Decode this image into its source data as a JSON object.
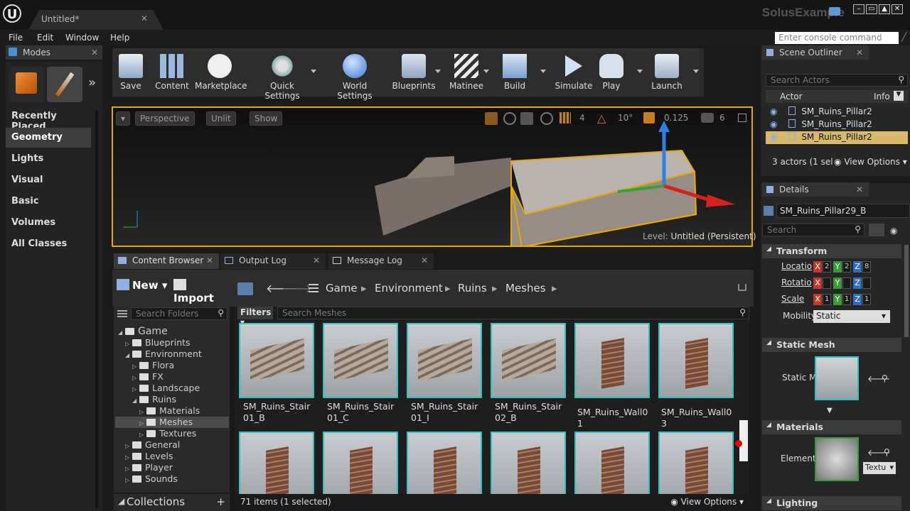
{
  "app": {
    "logo": "U",
    "project": "SolusExample",
    "doc_tab": "Untitled*"
  },
  "menu": [
    "File",
    "Edit",
    "Window",
    "Help"
  ],
  "console_placeholder": "Enter console command",
  "modes": {
    "tab": "Modes",
    "categories": [
      "Recently Placed",
      "Geometry",
      "Lights",
      "Visual",
      "Basic",
      "Volumes",
      "All Classes"
    ],
    "selected": "Geometry"
  },
  "toolbar": [
    "Save",
    "Content",
    "Marketplace",
    "Quick Settings",
    "World Settings",
    "Blueprints",
    "Matinee",
    "Build",
    "Simulate",
    "Play",
    "Launch"
  ],
  "viewport": {
    "perspective": "Perspective",
    "unlit": "Unlit",
    "show": "Show",
    "grid": "4",
    "rot": "10°",
    "scale": "0.125",
    "cam": "6",
    "level_label": "Level:",
    "level_name": "Untitled (Persistent)"
  },
  "bottom_tabs": [
    "Content Browser",
    "Output Log",
    "Message Log"
  ],
  "content_browser": {
    "new": "New",
    "import": "Import",
    "path": [
      "Game",
      "Environment",
      "Ruins",
      "Meshes"
    ],
    "folder_search": "Search Folders",
    "filters": "Filters",
    "asset_search": "Search Meshes",
    "tree": [
      {
        "label": "Game",
        "depth": 0,
        "open": true
      },
      {
        "label": "Blueprints",
        "depth": 1
      },
      {
        "label": "Environment",
        "depth": 1,
        "open": true
      },
      {
        "label": "Flora",
        "depth": 2
      },
      {
        "label": "FX",
        "depth": 2
      },
      {
        "label": "Landscape",
        "depth": 2
      },
      {
        "label": "Ruins",
        "depth": 2,
        "open": true
      },
      {
        "label": "Materials",
        "depth": 3
      },
      {
        "label": "Meshes",
        "depth": 3,
        "selected": true
      },
      {
        "label": "Textures",
        "depth": 3
      },
      {
        "label": "General",
        "depth": 1
      },
      {
        "label": "Levels",
        "depth": 1
      },
      {
        "label": "Player",
        "depth": 1
      },
      {
        "label": "Sounds",
        "depth": 1
      }
    ],
    "assets": [
      "SM_Ruins_Stair01_B",
      "SM_Ruins_Stair01_C",
      "SM_Ruins_Stair01_I",
      "SM_Ruins_Stair02_B",
      "SM_Ruins_Wall01",
      "SM_Ruins_Wall03"
    ],
    "collections": "Collections",
    "status": "71 items (1 selected)",
    "view_options": "View Options"
  },
  "outliner": {
    "tab": "Scene Outliner",
    "search": "Search Actors",
    "col_actor": "Actor",
    "col_info": "Info",
    "actors": [
      "SM_Ruins_Pillar2",
      "SM_Ruins_Pillar2",
      "SM_Ruins_Pillar2"
    ],
    "selected_index": 2,
    "footer": "3 actors (1 sel",
    "view_options": "View Options"
  },
  "details": {
    "tab": "Details",
    "name": "SM_Ruins_Pillar29_B",
    "search": "Search",
    "transform": "Transform",
    "location": "Locatio",
    "rotation": "Rotatio",
    "scale": "Scale",
    "mobility": "Mobility",
    "mobility_value": "Static",
    "loc_vals": [
      "2",
      "2",
      "8"
    ],
    "rot_vals": [
      "",
      "",
      ""
    ],
    "scale_vals": [
      "1",
      "1",
      "1"
    ],
    "static_mesh": "Static Mesh",
    "static_mesh_label": "Static M",
    "materials": "Materials",
    "element": "Element",
    "texture_drop": "Textu",
    "lighting": "Lighting"
  }
}
